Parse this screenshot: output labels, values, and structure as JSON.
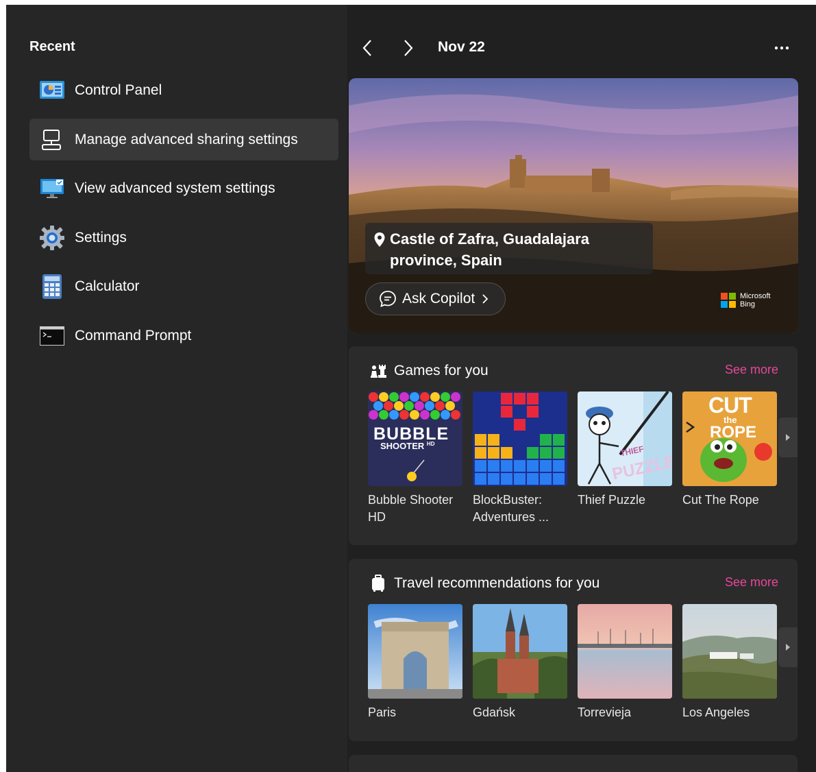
{
  "recent": {
    "title": "Recent",
    "items": [
      {
        "label": "Control Panel",
        "icon": "control-panel-icon"
      },
      {
        "label": "Manage advanced sharing settings",
        "icon": "network-sharing-icon",
        "selected": true
      },
      {
        "label": "View advanced system settings",
        "icon": "system-settings-icon"
      },
      {
        "label": "Settings",
        "icon": "gear-icon"
      },
      {
        "label": "Calculator",
        "icon": "calculator-icon"
      },
      {
        "label": "Command Prompt",
        "icon": "command-prompt-icon"
      }
    ]
  },
  "nav": {
    "date": "Nov 22",
    "prev_icon": "chevron-left-icon",
    "next_icon": "chevron-right-icon",
    "more_icon": "more-options-icon"
  },
  "hero": {
    "location": "Castle of Zafra, Guadalajara province, Spain",
    "copilot_label": "Ask Copilot",
    "brand_line1": "Microsoft",
    "brand_line2": "Bing"
  },
  "games": {
    "title": "Games for you",
    "see_more": "See more",
    "items": [
      {
        "label": "Bubble Shooter HD",
        "art_title": "BUBBLE",
        "art_subtitle": "SHOOTER",
        "art_badge": "HD"
      },
      {
        "label": "BlockBuster: Adventures ..."
      },
      {
        "label": "Thief Puzzle",
        "art_title": "PUZZLE",
        "art_subtitle": "THIEF"
      },
      {
        "label": "Cut The Rope",
        "art_title": "CUT",
        "art_subtitle": "the",
        "art_badge": "ROPE"
      }
    ]
  },
  "travel": {
    "title": "Travel recommendations for you",
    "see_more": "See more",
    "items": [
      {
        "label": "Paris"
      },
      {
        "label": "Gdańsk"
      },
      {
        "label": "Torrevieja"
      },
      {
        "label": "Los Angeles"
      }
    ]
  },
  "colors": {
    "background": "#202020",
    "left_panel": "#262626",
    "card": "#2b2b2b",
    "accent_pink": "#e8479a",
    "selected_row": "#383838"
  }
}
